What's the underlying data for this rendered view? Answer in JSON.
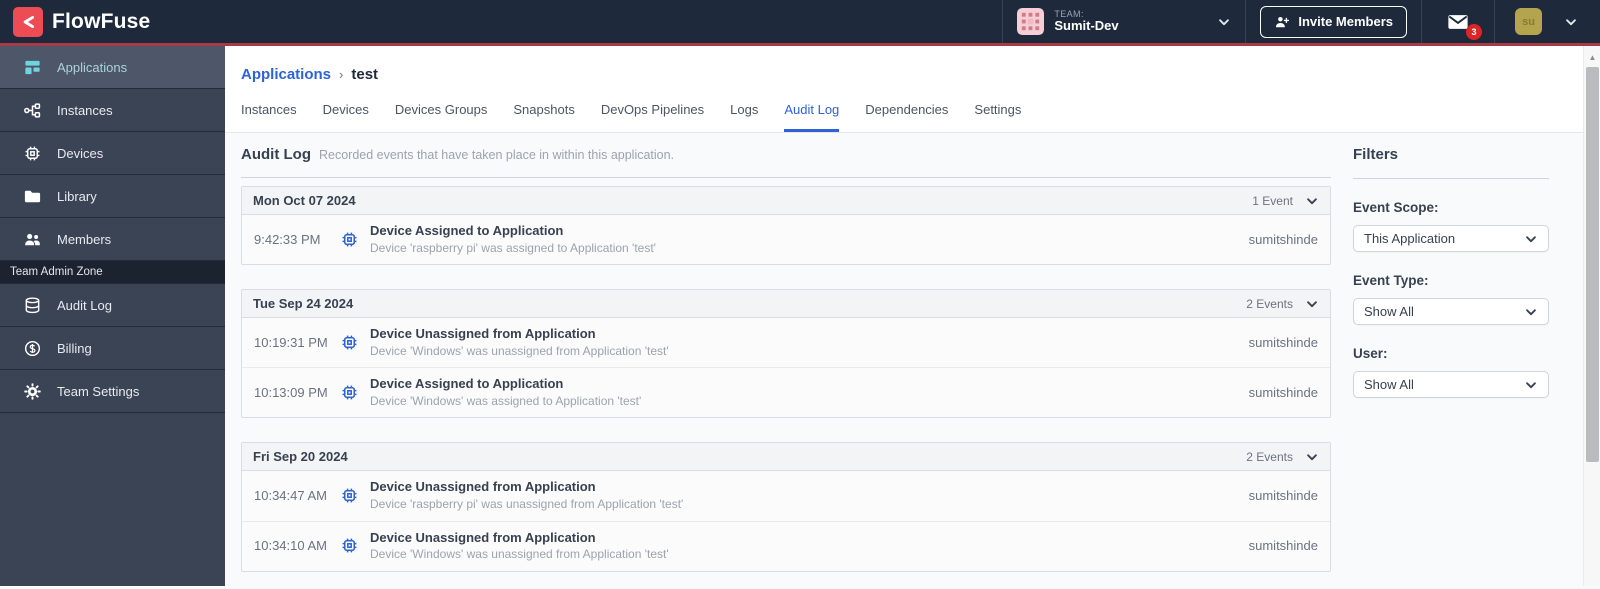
{
  "topbar": {
    "logo_text": "FlowFuse",
    "team_label": "TEAM:",
    "team_name": "Sumit-Dev",
    "invite_button_label": "Invite Members",
    "notification_count": "3",
    "avatar_initials": "su"
  },
  "sidebar": {
    "items": [
      {
        "label": "Applications",
        "icon": "applications-icon",
        "active": true
      },
      {
        "label": "Instances",
        "icon": "instances-icon",
        "active": false
      },
      {
        "label": "Devices",
        "icon": "chip-icon",
        "active": false
      },
      {
        "label": "Library",
        "icon": "folder-icon",
        "active": false
      },
      {
        "label": "Members",
        "icon": "users-icon",
        "active": false
      }
    ],
    "admin_section_label": "Team Admin Zone",
    "admin_items": [
      {
        "label": "Audit Log",
        "icon": "database-icon"
      },
      {
        "label": "Billing",
        "icon": "dollar-circle-icon"
      },
      {
        "label": "Team Settings",
        "icon": "gear-icon"
      }
    ]
  },
  "breadcrumb": {
    "parent": "Applications",
    "separator": "›",
    "current": "test"
  },
  "tabs": {
    "items": [
      {
        "label": "Instances"
      },
      {
        "label": "Devices"
      },
      {
        "label": "Devices Groups"
      },
      {
        "label": "Snapshots"
      },
      {
        "label": "DevOps Pipelines"
      },
      {
        "label": "Logs"
      },
      {
        "label": "Audit Log",
        "active": true
      },
      {
        "label": "Dependencies"
      },
      {
        "label": "Settings"
      }
    ]
  },
  "audit": {
    "title": "Audit Log",
    "subtitle": "Recorded events that have taken place in within this application.",
    "groups": [
      {
        "date": "Mon Oct 07 2024",
        "count_label": "1 Event",
        "events": [
          {
            "time": "9:42:33 PM",
            "title": "Device Assigned to Application",
            "description": "Device 'raspberry pi' was assigned to Application 'test'",
            "user": "sumitshinde"
          }
        ]
      },
      {
        "date": "Tue Sep 24 2024",
        "count_label": "2 Events",
        "events": [
          {
            "time": "10:19:31 PM",
            "title": "Device Unassigned from Application",
            "description": "Device 'Windows' was unassigned from Application 'test'",
            "user": "sumitshinde"
          },
          {
            "time": "10:13:09 PM",
            "title": "Device Assigned to Application",
            "description": "Device 'Windows' was assigned to Application 'test'",
            "user": "sumitshinde"
          }
        ]
      },
      {
        "date": "Fri Sep 20 2024",
        "count_label": "2 Events",
        "events": [
          {
            "time": "10:34:47 AM",
            "title": "Device Unassigned from Application",
            "description": "Device 'raspberry pi' was unassigned from Application 'test'",
            "user": "sumitshinde"
          },
          {
            "time": "10:34:10 AM",
            "title": "Device Unassigned from Application",
            "description": "Device 'Windows' was unassigned from Application 'test'",
            "user": "sumitshinde"
          }
        ]
      }
    ]
  },
  "filters": {
    "title": "Filters",
    "fields": [
      {
        "label": "Event Scope:",
        "value": "This Application"
      },
      {
        "label": "Event Type:",
        "value": "Show All"
      },
      {
        "label": "User:",
        "value": "Show All"
      }
    ]
  },
  "colors": {
    "topbar_bg": "#1e293b",
    "topbar_accent_red": "#a83a48",
    "logo_red": "#ee4c55",
    "sidebar_bg": "#3b4455",
    "sidebar_active_bg": "#4d5769",
    "active_icon_teal": "#6cd5dd",
    "link_blue": "#2f62d4",
    "badge_red": "#dc2626",
    "event_icon_blue": "#2f62d4"
  }
}
